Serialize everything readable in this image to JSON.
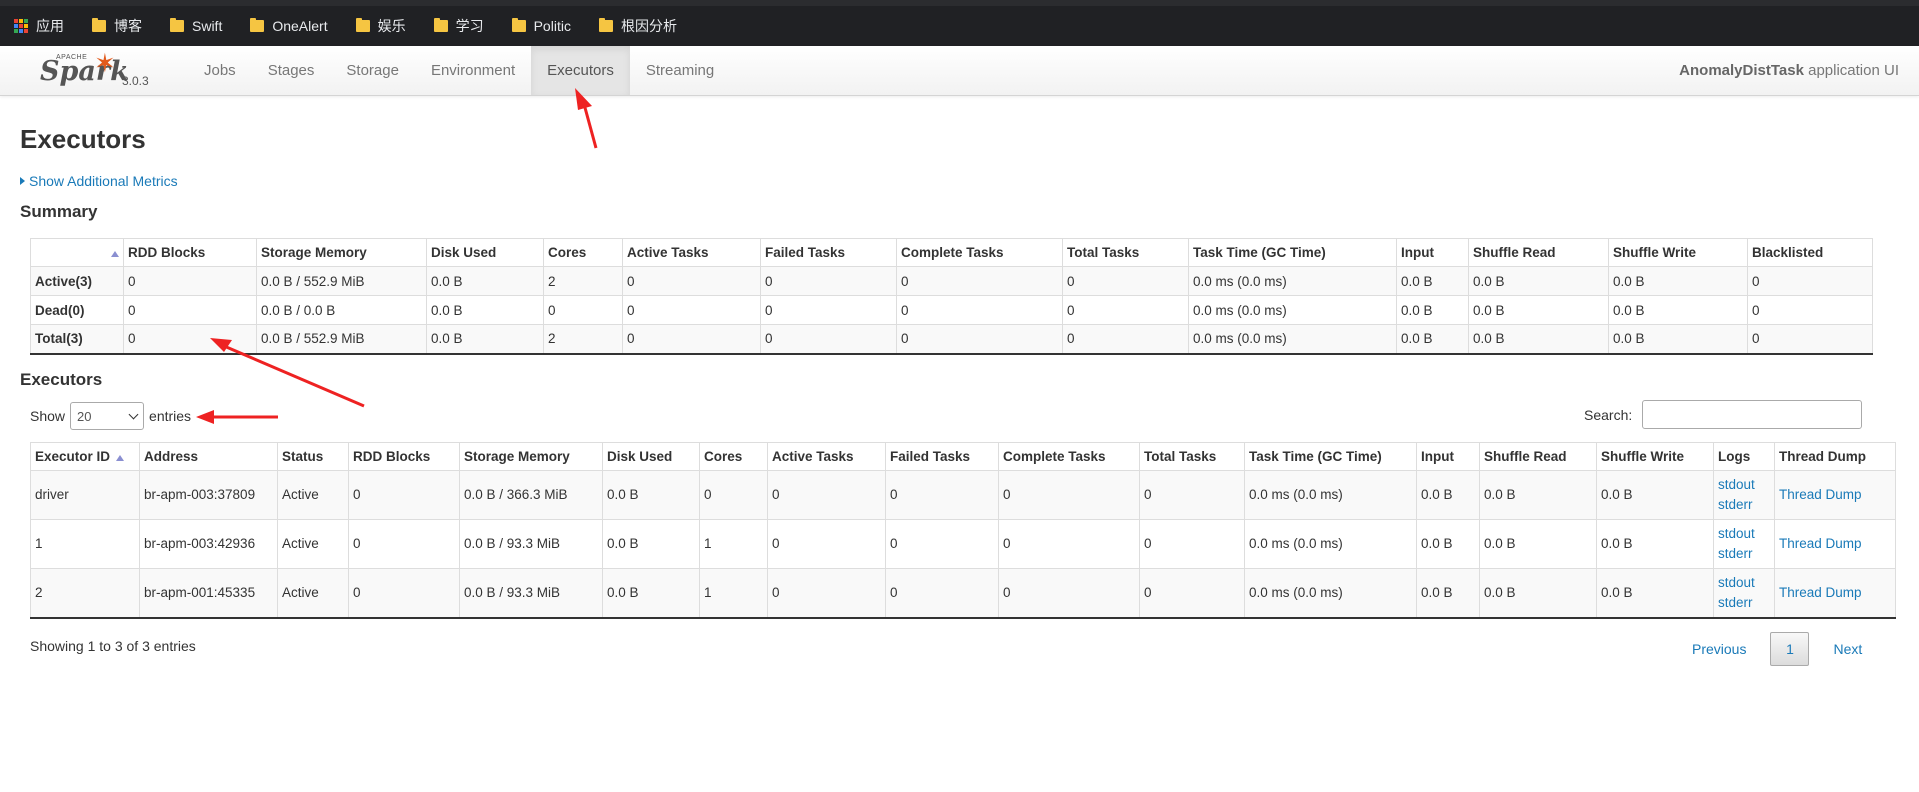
{
  "browser": {
    "bookmarks": [
      {
        "label": "应用",
        "icon": "apps-grid-icon"
      },
      {
        "label": "博客",
        "icon": "folder-icon"
      },
      {
        "label": "Swift",
        "icon": "folder-icon"
      },
      {
        "label": "OneAlert",
        "icon": "folder-icon"
      },
      {
        "label": "娱乐",
        "icon": "folder-icon"
      },
      {
        "label": "学习",
        "icon": "folder-icon"
      },
      {
        "label": "Politic",
        "icon": "folder-icon"
      },
      {
        "label": "根因分析",
        "icon": "folder-icon"
      }
    ]
  },
  "nav": {
    "brand_apache": "APACHE",
    "brand_word": "Spark",
    "version": "3.0.3",
    "tabs": [
      {
        "label": "Jobs",
        "active": false
      },
      {
        "label": "Stages",
        "active": false
      },
      {
        "label": "Storage",
        "active": false
      },
      {
        "label": "Environment",
        "active": false
      },
      {
        "label": "Executors",
        "active": true
      },
      {
        "label": "Streaming",
        "active": false
      }
    ],
    "app_name": "AnomalyDistTask",
    "app_suffix": "application UI"
  },
  "page": {
    "title": "Executors",
    "additional_metrics": "Show Additional Metrics",
    "summary_title": "Summary",
    "executors_title": "Executors"
  },
  "summary": {
    "headers": [
      "",
      "RDD Blocks",
      "Storage Memory",
      "Disk Used",
      "Cores",
      "Active Tasks",
      "Failed Tasks",
      "Complete Tasks",
      "Total Tasks",
      "Task Time (GC Time)",
      "Input",
      "Shuffle Read",
      "Shuffle Write",
      "Blacklisted"
    ],
    "rows": [
      [
        "Active(3)",
        "0",
        "0.0 B / 552.9 MiB",
        "0.0 B",
        "2",
        "0",
        "0",
        "0",
        "0",
        "0.0 ms (0.0 ms)",
        "0.0 B",
        "0.0 B",
        "0.0 B",
        "0"
      ],
      [
        "Dead(0)",
        "0",
        "0.0 B / 0.0 B",
        "0.0 B",
        "0",
        "0",
        "0",
        "0",
        "0",
        "0.0 ms (0.0 ms)",
        "0.0 B",
        "0.0 B",
        "0.0 B",
        "0"
      ],
      [
        "Total(3)",
        "0",
        "0.0 B / 552.9 MiB",
        "0.0 B",
        "2",
        "0",
        "0",
        "0",
        "0",
        "0.0 ms (0.0 ms)",
        "0.0 B",
        "0.0 B",
        "0.0 B",
        "0"
      ]
    ]
  },
  "controls": {
    "show_label": "Show",
    "entries_value": "20",
    "entries_label": "entries",
    "search_label": "Search:",
    "search_value": ""
  },
  "executors": {
    "headers": [
      "Executor ID",
      "Address",
      "Status",
      "RDD Blocks",
      "Storage Memory",
      "Disk Used",
      "Cores",
      "Active Tasks",
      "Failed Tasks",
      "Complete Tasks",
      "Total Tasks",
      "Task Time (GC Time)",
      "Input",
      "Shuffle Read",
      "Shuffle Write",
      "Logs",
      "Thread Dump"
    ],
    "rows": [
      {
        "id": "driver",
        "address": "br-apm-003:37809",
        "status": "Active",
        "rdd": "0",
        "storage": "0.0 B / 366.3 MiB",
        "disk": "0.0 B",
        "cores": "0",
        "active": "0",
        "failed": "0",
        "complete": "0",
        "total": "0",
        "time": "0.0 ms (0.0 ms)",
        "input": "0.0 B",
        "sread": "0.0 B",
        "swrite": "0.0 B",
        "stdout": "stdout",
        "stderr": "stderr",
        "dump": "Thread Dump"
      },
      {
        "id": "1",
        "address": "br-apm-003:42936",
        "status": "Active",
        "rdd": "0",
        "storage": "0.0 B / 93.3 MiB",
        "disk": "0.0 B",
        "cores": "1",
        "active": "0",
        "failed": "0",
        "complete": "0",
        "total": "0",
        "time": "0.0 ms (0.0 ms)",
        "input": "0.0 B",
        "sread": "0.0 B",
        "swrite": "0.0 B",
        "stdout": "stdout",
        "stderr": "stderr",
        "dump": "Thread Dump"
      },
      {
        "id": "2",
        "address": "br-apm-001:45335",
        "status": "Active",
        "rdd": "0",
        "storage": "0.0 B / 93.3 MiB",
        "disk": "0.0 B",
        "cores": "1",
        "active": "0",
        "failed": "0",
        "complete": "0",
        "total": "0",
        "time": "0.0 ms (0.0 ms)",
        "input": "0.0 B",
        "sread": "0.0 B",
        "swrite": "0.0 B",
        "stdout": "stdout",
        "stderr": "stderr",
        "dump": "Thread Dump"
      }
    ]
  },
  "footer": {
    "showing": "Showing 1 to 3 of 3 entries",
    "previous": "Previous",
    "current_page": "1",
    "next": "Next"
  },
  "colors": {
    "link": "#1a7ab8",
    "spark_orange": "#e25a1c",
    "annotation_arrow": "#ee2222",
    "sort_arrow": "#8a8fd1"
  }
}
